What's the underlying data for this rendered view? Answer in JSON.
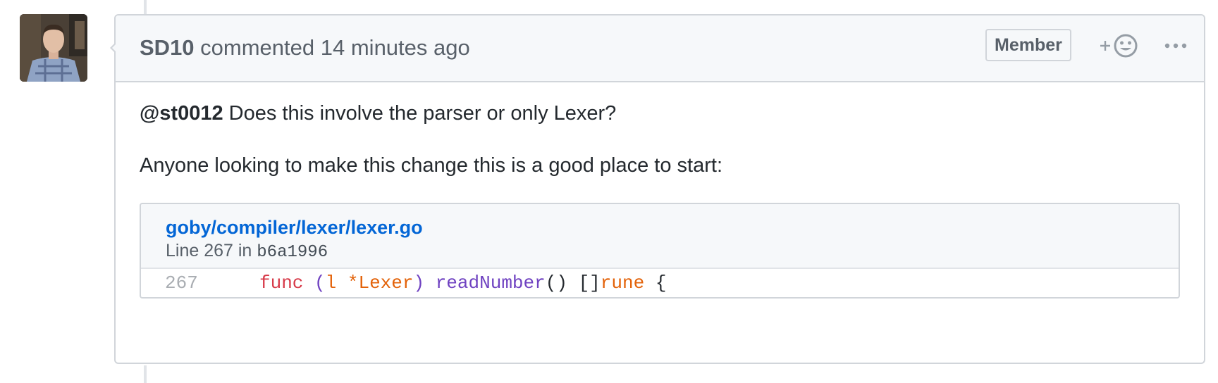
{
  "comment": {
    "author": "SD10",
    "action": "commented",
    "time": "14 minutes ago",
    "role_badge": "Member",
    "reaction_plus": "+",
    "more_label": "···"
  },
  "body": {
    "mention": "@st0012",
    "question": "Does this involve the parser or only Lexer?",
    "second_paragraph": "Anyone looking to make this change this is a good place to start:"
  },
  "code_embed": {
    "file_path": "goby/compiler/lexer/lexer.go",
    "line_prefix": "Line 267 in",
    "commit": "b6a1996",
    "line_number": "267",
    "code_tokens": {
      "func": "func",
      "open_paren": "(",
      "receiver": "l",
      "pointer_type": "*Lexer",
      "close_paren": ")",
      "method": "readNumber",
      "call_parens": "()",
      "slice": "[]",
      "rune": "rune",
      "brace": "{"
    }
  },
  "colors": {
    "link": "#0366d6",
    "keyword": "#d73a49",
    "function": "#6f42c1",
    "variable": "#e36209"
  }
}
